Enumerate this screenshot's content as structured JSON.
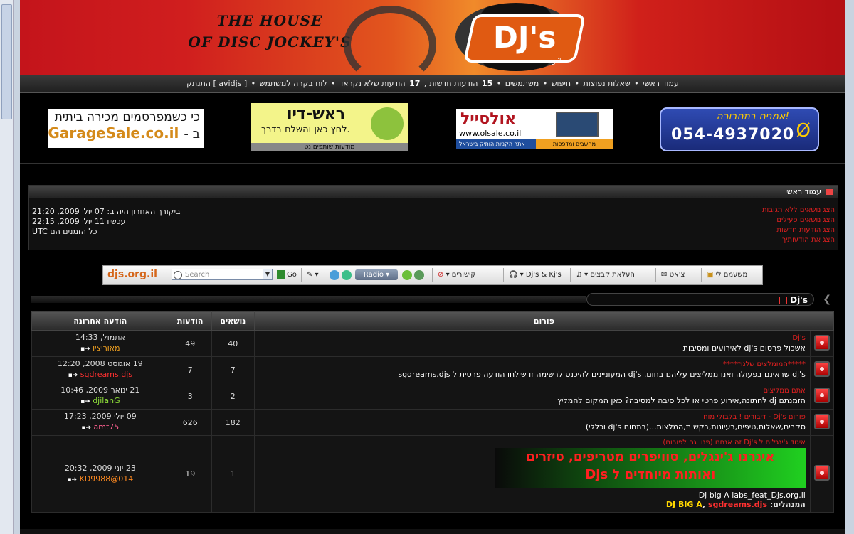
{
  "banner": {
    "tagline_1": "THE HOUSE",
    "tagline_2": "OF DISC JOCKEY'S",
    "logo": "DJ's",
    "logo_sub": ".org.il"
  },
  "navbar": {
    "items": [
      "עמוד ראשי",
      "שאלות נפוצות",
      "חיפוש",
      "משתמשים"
    ],
    "stats_users": "15",
    "stats_unread": "17",
    "unread_label": "הודעות חדשות",
    "unread_label2": "הודעות שלא נקראו",
    "control_panel": "לוח בקרה למשתמש",
    "logout": "[ avidjs ] התנתק"
  },
  "ads": {
    "garagesale_line1": "כי כשמפרסמים מכירה ביתית",
    "garagesale_line2_prefix": "ב -",
    "garagesale_site": "GarageSale.co.il",
    "roshdio_title": "ראש-דיו",
    "roshdio_sub": "לחץ כאן והשלח בדרך.",
    "roshdio_caption": "מודעות שותפים.נט",
    "olsale_name": "אולסייל",
    "olsale_site": "www.olsale.co.il",
    "olsale_foot_left": "אתר הקניות הותיק בישראל",
    "olsale_foot_right": "מחשבים ומדפסות",
    "phone_ad_title": "אמנים בתחבורה!",
    "phone_ad_number": "054-4937020",
    "phone_ad_symbol": "Ø"
  },
  "info": {
    "header": "עמוד ראשי",
    "links": [
      "הצג נושאים ללא תגובות",
      "הצג נושאים פעילים",
      "הצג הודעות חדשות",
      "הצג את הודעותיך"
    ],
    "last_visit": "ביקורך האחרון היה ב: 07 יולי 2009, 21:20",
    "now": "עכשיו 11 יולי 2009, 22:15",
    "timezone": "כל הזמנים הם UTC"
  },
  "toolbar": {
    "brand": "djs.org.il",
    "search_placeholder": "Search",
    "go": "Go",
    "radio": "Radio",
    "links": "קישורים",
    "djs_kjs": "Dj's & Kj's",
    "upload": "העלאת קבצים",
    "chat": "צ'אט",
    "boring": "משעמם לי"
  },
  "forum": {
    "title": "Dj's",
    "columns": {
      "forum": "פורום",
      "topics": "נושאים",
      "posts": "הודעות",
      "last": "הודעה אחרונה"
    },
    "rows": [
      {
        "name": "Dj's",
        "desc": "אשכול פרסום dj's לאירועים ומסיבות",
        "topics": "40",
        "posts": "49",
        "last_date": "אתמול, 14:33",
        "last_user": "מאוריציו",
        "user_class": "or"
      },
      {
        "name": "*****המומלצים שלנו*****",
        "desc": "dj's שראינם בפעולה ואנו ממליצים עליהם בחום. dj's המעוניינים להיכנס לרשימה זו שילחו הודעה פרטית ל sgdreams.djs",
        "topics": "7",
        "posts": "7",
        "last_date": "19 אוגוסט 2008, 12:20",
        "last_user": "sgdreams.djs",
        "user_class": "rd"
      },
      {
        "name": "אתם ממליצים",
        "desc": "הזמנתם dj לחתונה,אירוע פרטי או לכל סיבה למסיבה? כאן המקום להמליץ",
        "topics": "2",
        "posts": "3",
        "last_date": "21 ינואר 2009, 10:46",
        "last_user": "djilanG",
        "user_class": "gr"
      },
      {
        "name": "פורום Dj's - דיבורים ! בלבולי מוח",
        "desc": "סקרים,שאלות,טיפים,רעיונות,בקשות,המלצות...(בתחום dj's וכללי)",
        "topics": "182",
        "posts": "626",
        "last_date": "09 יולי 2009, 17:23",
        "last_user": "amt75",
        "user_class": "pk"
      },
      {
        "name": "איגוד ג'ינגלים ל Dj's זה אנחנו (פנוו גם לפורום)",
        "promo1": "איגרנו ג'ינגלים, סוויפרים מטריפים, טיזרים",
        "promo2": "ואותות מיוחדים ל Djs",
        "desc": "Dj big A labs_feat_Djs.org.il",
        "mods_label": "המנהלים:",
        "mod1": "DJ BIG A",
        "mod2": "sgdreams.djs",
        "topics": "1",
        "posts": "19",
        "last_date": "23 יוני 2009, 20:32",
        "last_user": "KD9988@014",
        "user_class": "o2"
      }
    ]
  }
}
